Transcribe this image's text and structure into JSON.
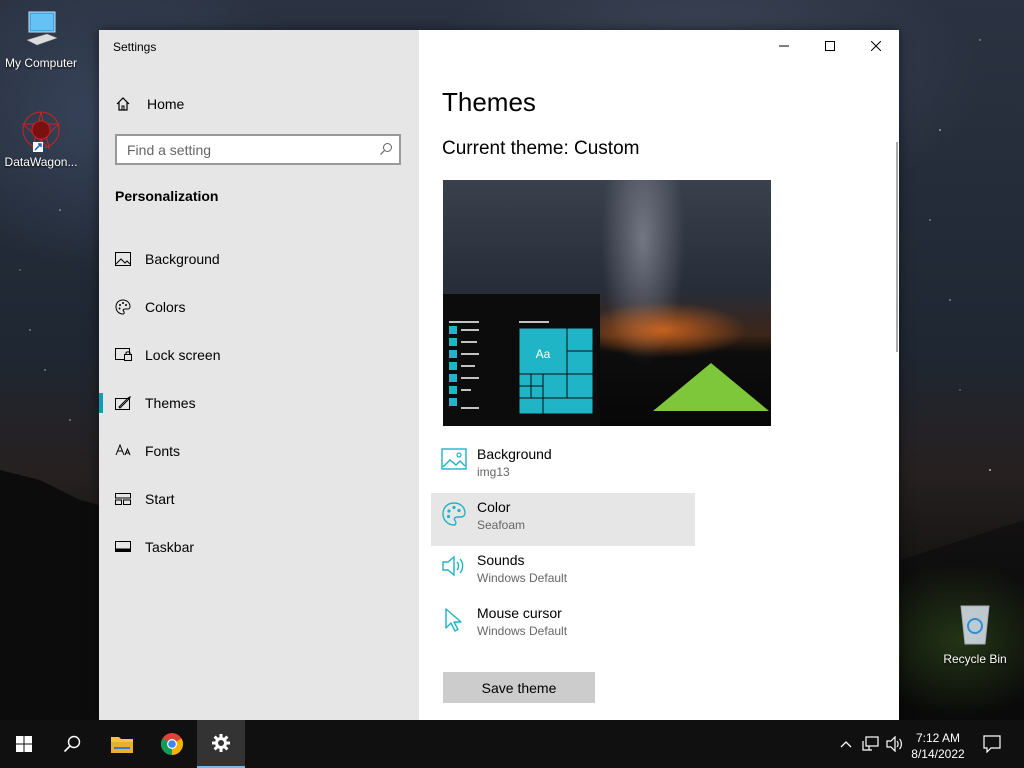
{
  "desktop": {
    "icons": [
      {
        "label": "My Computer",
        "icon": "computer-icon"
      },
      {
        "label": "DataWagon...",
        "icon": "datawagon-app-icon"
      },
      {
        "label": "Recycle Bin",
        "icon": "recycle-bin-icon"
      }
    ]
  },
  "window": {
    "title": "Settings",
    "controls": [
      "minimize",
      "maximize",
      "close"
    ]
  },
  "sidebar": {
    "home_label": "Home",
    "search_placeholder": "Find a setting",
    "section_title": "Personalization",
    "items": [
      {
        "label": "Background",
        "icon": "picture-icon"
      },
      {
        "label": "Colors",
        "icon": "palette-icon"
      },
      {
        "label": "Lock screen",
        "icon": "lock-screen-icon"
      },
      {
        "label": "Themes",
        "icon": "themes-icon",
        "selected": true
      },
      {
        "label": "Fonts",
        "icon": "fonts-icon"
      },
      {
        "label": "Start",
        "icon": "start-icon"
      },
      {
        "label": "Taskbar",
        "icon": "taskbar-icon"
      }
    ]
  },
  "main": {
    "title": "Themes",
    "current_theme_label": "Current theme:",
    "current_theme_value": "Custom",
    "preview_tile_text": "Aa",
    "accent_color": "#1fb4c6",
    "theme_items": [
      {
        "title": "Background",
        "value": "img13",
        "icon": "picture-icon"
      },
      {
        "title": "Color",
        "value": "Seafoam",
        "icon": "palette-icon",
        "highlighted": true
      },
      {
        "title": "Sounds",
        "value": "Windows Default",
        "icon": "speaker-icon"
      },
      {
        "title": "Mouse cursor",
        "value": "Windows Default",
        "icon": "cursor-icon"
      }
    ],
    "save_button": "Save theme"
  },
  "taskbar": {
    "time": "7:12 AM",
    "date": "8/14/2022"
  }
}
